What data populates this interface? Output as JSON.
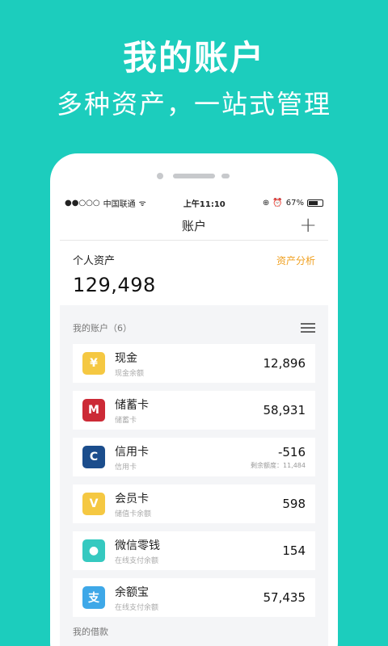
{
  "hero": {
    "title": "我的账户",
    "subtitle": "多种资产，一站式管理"
  },
  "status_bar": {
    "signal": "●●○○○",
    "carrier": "中国联通",
    "wifi": "ᯤ",
    "time": "上午11:10",
    "battery": "67%",
    "battery_level": 0.67
  },
  "nav": {
    "title": "账户",
    "add_icon": "plus-icon"
  },
  "summary": {
    "label": "个人资产",
    "value": "129,498",
    "link": "资产分析"
  },
  "section": {
    "title": "我的账户（6）",
    "icon": "list-icon"
  },
  "accounts": [
    {
      "name": "现金",
      "sub": "现金余额",
      "amount": "12,896",
      "note": "",
      "icon": "cash-icon",
      "glyph": "¥",
      "color": "#f5c842"
    },
    {
      "name": "储蓄卡",
      "sub": "储蓄卡",
      "amount": "58,931",
      "note": "",
      "icon": "bank-card-icon",
      "glyph": "M",
      "color": "#cc2a36"
    },
    {
      "name": "信用卡",
      "sub": "信用卡",
      "amount": "-516",
      "note": "剩余额度：11,484",
      "icon": "credit-card-icon",
      "glyph": "C",
      "color": "#1b4d8c"
    },
    {
      "name": "会员卡",
      "sub": "储值卡余额",
      "amount": "598",
      "note": "",
      "icon": "member-card-icon",
      "glyph": "V",
      "color": "#f5c842"
    },
    {
      "name": "微信零钱",
      "sub": "在线支付余额",
      "amount": "154",
      "note": "",
      "icon": "wechat-icon",
      "glyph": "●",
      "color": "#35c9c0"
    },
    {
      "name": "余额宝",
      "sub": "在线支付余额",
      "amount": "57,435",
      "note": "",
      "icon": "alipay-icon",
      "glyph": "支",
      "color": "#3ea8e8"
    }
  ],
  "loans": {
    "title": "我的借款"
  }
}
